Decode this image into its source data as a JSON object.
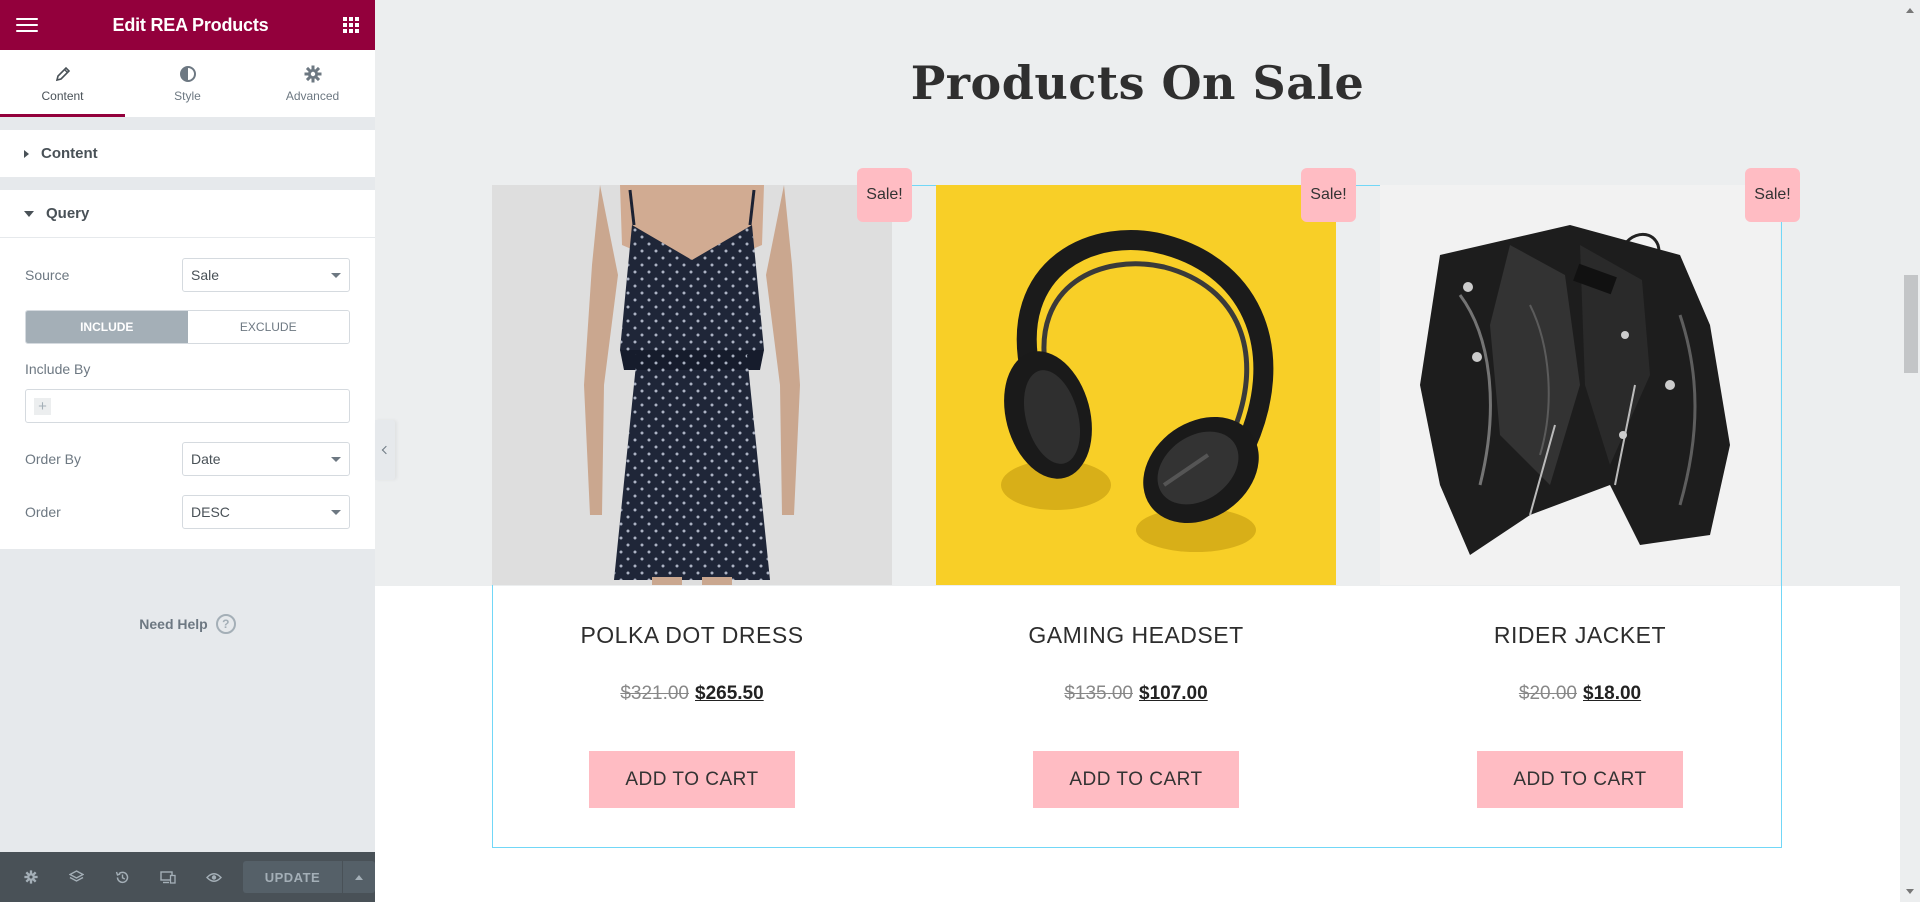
{
  "panel": {
    "title": "Edit REA Products",
    "tabs": [
      {
        "label": "Content",
        "icon": "pencil-icon"
      },
      {
        "label": "Style",
        "icon": "half-circle-icon"
      },
      {
        "label": "Advanced",
        "icon": "gear-icon"
      }
    ],
    "sections": {
      "content": {
        "label": "Content"
      },
      "query": {
        "label": "Query"
      }
    },
    "query": {
      "source_label": "Source",
      "source_value": "Sale",
      "include_label": "INCLUDE",
      "exclude_label": "EXCLUDE",
      "include_by_label": "Include By",
      "order_by_label": "Order By",
      "order_by_value": "Date",
      "order_label": "Order",
      "order_value": "DESC"
    },
    "need_help": "Need Help",
    "footer": {
      "update_label": "UPDATE",
      "icons": [
        "settings-icon",
        "layers-icon",
        "history-icon",
        "responsive-icon",
        "preview-eye-icon"
      ]
    },
    "accent_color": "#93003c"
  },
  "preview": {
    "section_title": "Products On Sale",
    "badge_color": "#ffbcc3",
    "products": [
      {
        "name": "POLKA DOT DRESS",
        "old_price": "$321.00",
        "price": "$265.50",
        "badge": "Sale!",
        "button": "ADD TO CART",
        "image": "polka-dot-dress-photo"
      },
      {
        "name": "GAMING HEADSET",
        "old_price": "$135.00",
        "price": "$107.00",
        "badge": "Sale!",
        "button": "ADD TO CART",
        "image": "headphones-on-yellow-photo"
      },
      {
        "name": "RIDER JACKET",
        "old_price": "$20.00",
        "price": "$18.00",
        "badge": "Sale!",
        "button": "ADD TO CART",
        "image": "leather-jacket-photo"
      }
    ]
  }
}
